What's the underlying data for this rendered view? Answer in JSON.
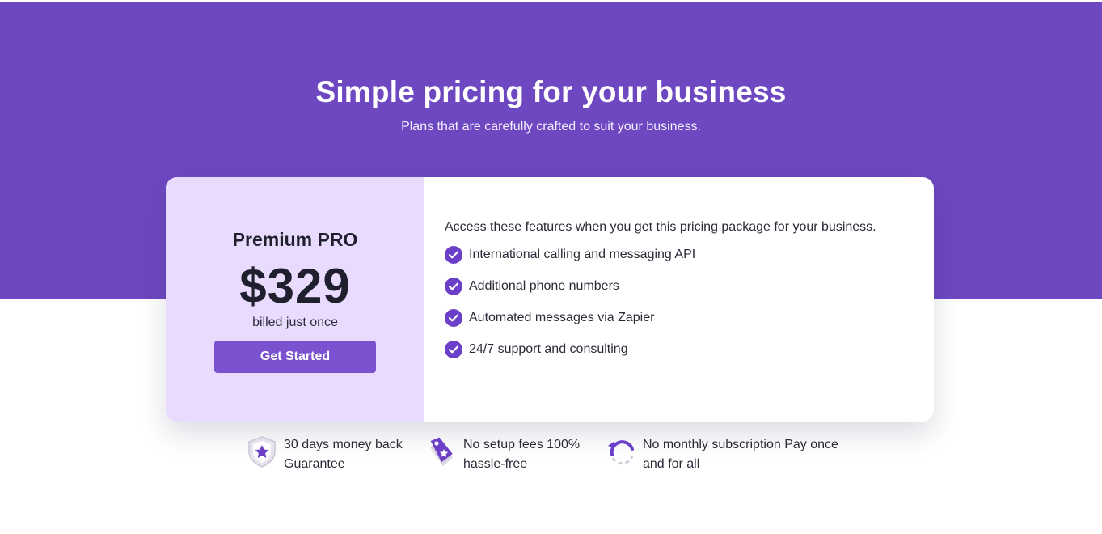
{
  "hero": {
    "title": "Simple pricing for your business",
    "subtitle": "Plans that are carefully crafted to suit your business."
  },
  "plan": {
    "name": "Premium PRO",
    "price": "$329",
    "billing": "billed just once",
    "cta_label": "Get Started"
  },
  "features": {
    "intro": "Access these features when you get this pricing package for your business.",
    "items": [
      {
        "label": "International calling and messaging API",
        "icon": "check-circle-icon"
      },
      {
        "label": "Additional phone numbers",
        "icon": "check-circle-icon"
      },
      {
        "label": "Automated messages via Zapier",
        "icon": "check-circle-icon"
      },
      {
        "label": "24/7 support and consulting",
        "icon": "check-circle-icon"
      }
    ]
  },
  "guarantees": [
    {
      "line1": "30 days money back",
      "line2": "Guarantee",
      "icon": "shield-star-icon"
    },
    {
      "line1": "No setup fees 100%",
      "line2": "hassle-free",
      "icon": "price-tag-icon"
    },
    {
      "line1": "No monthly subscription Pay once",
      "line2": "and for all",
      "icon": "refresh-arrow-icon"
    }
  ],
  "colors": {
    "hero_bg": "#6d48c1",
    "accent": "#6c3fc8",
    "button": "#7a51cf",
    "plan_panel_bg": "#e9dbfd"
  }
}
